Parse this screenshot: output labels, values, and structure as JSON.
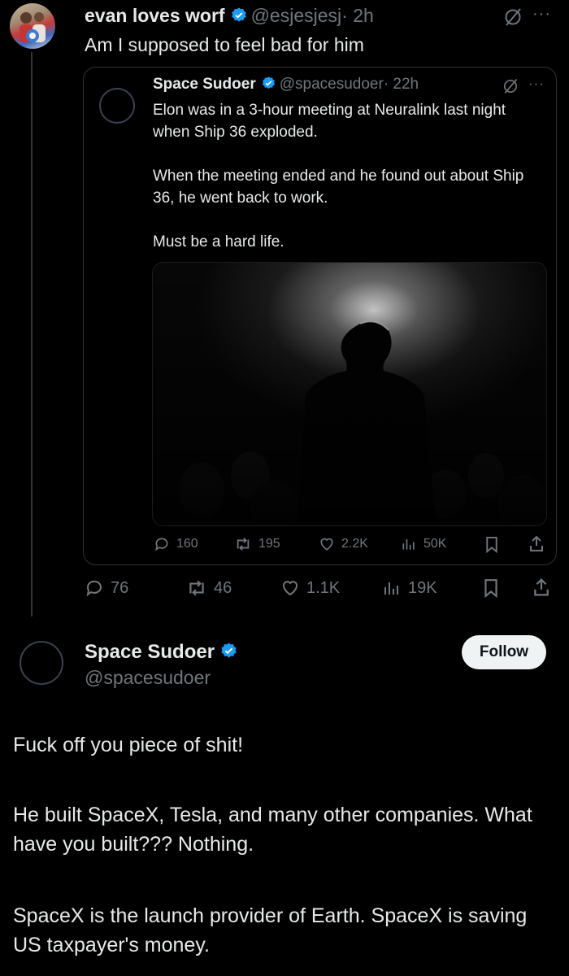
{
  "main_tweet": {
    "display_name": "evan loves worf",
    "handle": "@esjesjesj",
    "time": "· 2h",
    "text": "Am I supposed to feel bad for him",
    "actions": {
      "replies": "76",
      "reposts": "46",
      "likes": "1.1K",
      "views": "19K"
    }
  },
  "quoted_tweet": {
    "display_name": "Space Sudoer",
    "handle": "@spacesudoer",
    "time": "· 22h",
    "text": "Elon was in a 3-hour meeting at Neuralink last night when Ship 36 exploded.\n\nWhen the meeting ended and he found out about Ship 36, he went back to work.\n\nMust be a hard life.",
    "actions": {
      "replies": "160",
      "reposts": "195",
      "likes": "2.2K",
      "views": "50K"
    }
  },
  "reply": {
    "display_name": "Space Sudoer",
    "handle": "@spacesudoer",
    "follow_label": "Follow",
    "paragraph1": "Fuck off you piece of shit!",
    "paragraph2": "He built SpaceX, Tesla, and many other companies. What have you built??? Nothing.",
    "paragraph3": "SpaceX is the launch provider of Earth. SpaceX is saving US taxpayer's money."
  },
  "colors": {
    "verified": "#1d9bf0",
    "muted": "#71767b",
    "text": "#e7e9ea",
    "border": "#2f3336"
  }
}
